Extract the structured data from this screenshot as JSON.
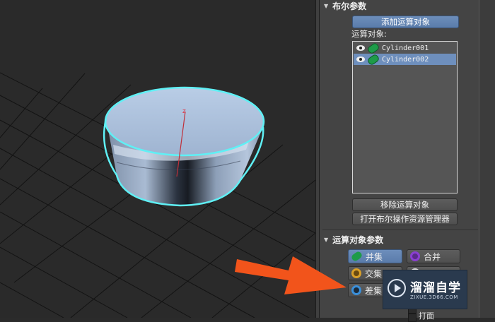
{
  "boolean_params": {
    "title": "布尔参数",
    "add_operand_label": "添加运算对象",
    "operands_label": "运算对象:",
    "operands": [
      {
        "name": "Cylinder001",
        "selected": false
      },
      {
        "name": "Cylinder002",
        "selected": true
      }
    ],
    "remove_operand_label": "移除运算对象",
    "open_explorer_label": "打开布尔操作资源管理器"
  },
  "operand_params": {
    "title": "运算对象参数",
    "ops": [
      {
        "label": "并集",
        "icon": "union-icon",
        "color": "#1e9b49",
        "active": true
      },
      {
        "label": "合并",
        "icon": "merge-icon",
        "color": "#8a3fd1",
        "active": false
      },
      {
        "label": "交集",
        "icon": "intersection-icon",
        "color": "#d9a02a",
        "active": false
      },
      {
        "label": "差集",
        "icon": "subtraction-icon",
        "color": "#3a8fd9",
        "active": false
      }
    ],
    "partial_label": "打面"
  },
  "viewport": {
    "axis_label": "z"
  },
  "watermark": {
    "title": "溜溜自学",
    "url": "ZIXUE.3D66.COM"
  },
  "colors": {
    "selection_blue": "#6e8fbd",
    "highlight_cyan": "#5ff0f5",
    "arrow_orange": "#f2541b"
  }
}
